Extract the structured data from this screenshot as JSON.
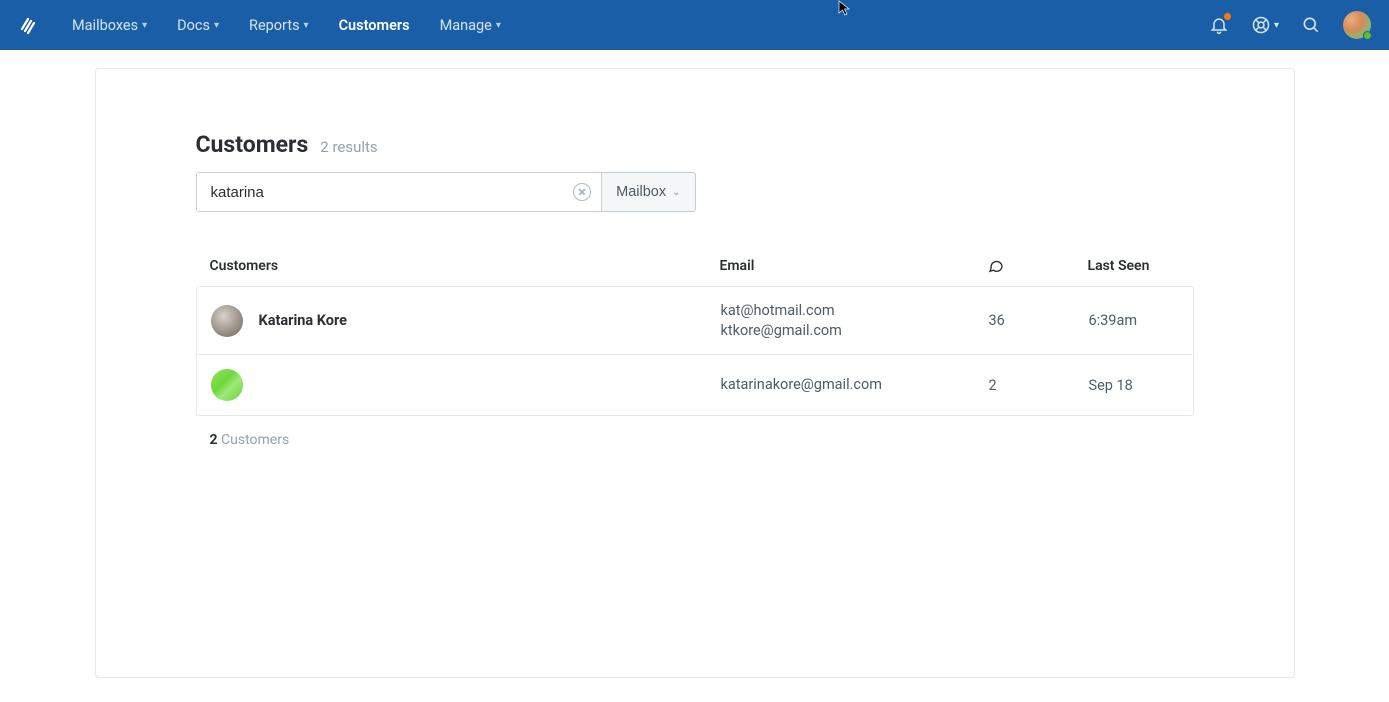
{
  "header": {
    "nav": [
      {
        "label": "Mailboxes",
        "hasDropdown": true
      },
      {
        "label": "Docs",
        "hasDropdown": true
      },
      {
        "label": "Reports",
        "hasDropdown": true
      },
      {
        "label": "Customers",
        "hasDropdown": false,
        "active": true
      },
      {
        "label": "Manage",
        "hasDropdown": true
      }
    ]
  },
  "page": {
    "title": "Customers",
    "results_text": "2 results"
  },
  "search": {
    "value": "katarina",
    "mailbox_label": "Mailbox"
  },
  "table": {
    "headers": {
      "customers": "Customers",
      "email": "Email",
      "last_seen": "Last Seen"
    },
    "rows": [
      {
        "name": "Katarina Kore",
        "emails": [
          "kat@hotmail.com",
          "ktkore@gmail.com"
        ],
        "conversations": "36",
        "last_seen": "6:39am",
        "avatar_class": "av1"
      },
      {
        "name": "",
        "emails": [
          "katarinakore@gmail.com"
        ],
        "conversations": "2",
        "last_seen": "Sep 18",
        "avatar_class": "av2"
      }
    ]
  },
  "footer": {
    "count": "2",
    "label": "Customers"
  }
}
